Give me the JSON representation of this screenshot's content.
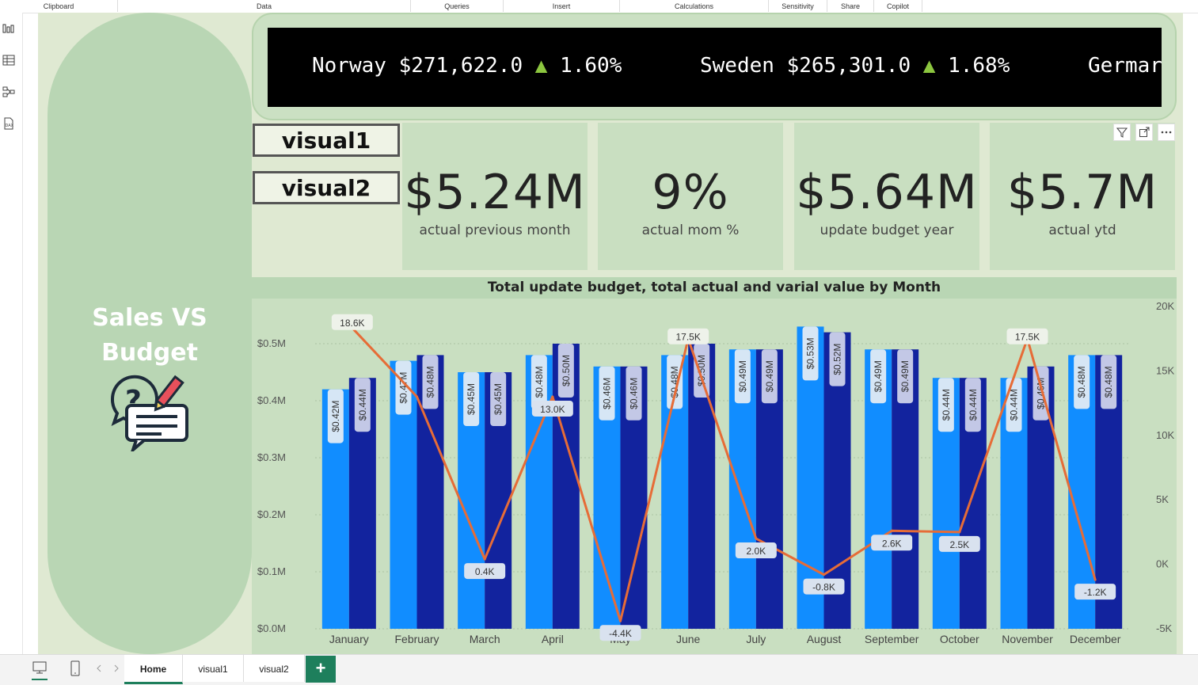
{
  "ribbon": {
    "groups": [
      {
        "label": "Clipboard"
      },
      {
        "label": "Data"
      },
      {
        "label": "Queries"
      },
      {
        "label": "Insert"
      },
      {
        "label": "Calculations"
      },
      {
        "label": "Sensitivity"
      },
      {
        "label": "Share"
      },
      {
        "label": "Copilot"
      }
    ]
  },
  "leftnav": [
    "report-view-icon",
    "table-view-icon",
    "model-view-icon",
    "dax-query-icon"
  ],
  "page": {
    "title": "Sales VS Budget",
    "title_line1": "Sales VS",
    "title_line2": "Budget"
  },
  "ticker": {
    "items": [
      {
        "country": "Norway",
        "value": "$271,622.0",
        "arrow": "▲",
        "change": "1.60%"
      },
      {
        "country": "Sweden",
        "value": "$265,301.0",
        "arrow": "▲",
        "change": "1.68%"
      },
      {
        "country": "Germar",
        "value": "",
        "arrow": "",
        "change": ""
      }
    ]
  },
  "nav_buttons": {
    "visual1": "visual1",
    "visual2": "visual2"
  },
  "cards": [
    {
      "value": "$5.24M",
      "label": "actual previous month"
    },
    {
      "value": "9%",
      "label": "actual mom %"
    },
    {
      "value": "$5.64M",
      "label": "update budget year"
    },
    {
      "value": "$5.7M",
      "label": "actual ytd"
    }
  ],
  "header_icons": [
    "filter-icon",
    "focus-mode-icon",
    "more-options-icon"
  ],
  "chart_data": {
    "type": "bar",
    "title": "Total update budget, total actual and varial value by Month",
    "categories": [
      "January",
      "February",
      "March",
      "April",
      "May",
      "June",
      "July",
      "August",
      "September",
      "October",
      "November",
      "December"
    ],
    "series": [
      {
        "name": "total update budget",
        "type": "bar",
        "color": "#118dff",
        "values": [
          0.42,
          0.47,
          0.45,
          0.48,
          0.46,
          0.48,
          0.49,
          0.53,
          0.49,
          0.44,
          0.44,
          0.48
        ],
        "labels": [
          "$0.42M",
          "$0.47M",
          "$0.45M",
          "$0.48M",
          "$0.46M",
          "$0.48M",
          "$0.49M",
          "$0.53M",
          "$0.49M",
          "$0.44M",
          "$0.44M",
          "$0.48M"
        ]
      },
      {
        "name": "total actual",
        "type": "bar",
        "color": "#12239e",
        "values": [
          0.44,
          0.48,
          0.45,
          0.5,
          0.46,
          0.5,
          0.49,
          0.52,
          0.49,
          0.44,
          0.46,
          0.48
        ],
        "labels": [
          "$0.44M",
          "$0.48M",
          "$0.45M",
          "$0.50M",
          "$0.46M",
          "$0.50M",
          "$0.49M",
          "$0.52M",
          "$0.49M",
          "$0.44M",
          "$0.46M",
          "$0.48M"
        ]
      },
      {
        "name": "varial value",
        "type": "line",
        "color": "#e66c37",
        "values": [
          18.6,
          13.0,
          0.4,
          13.0,
          -4.4,
          17.5,
          2.0,
          -0.8,
          2.6,
          2.5,
          17.5,
          -1.2
        ],
        "labels": [
          "18.6K",
          "",
          "0.4K",
          "13.0K",
          "-4.4K",
          "17.5K",
          "2.0K",
          "-0.8K",
          "2.6K",
          "2.5K",
          "17.5K",
          "-1.2K"
        ]
      }
    ],
    "y_left": {
      "min": 0,
      "max": 0.5,
      "ticks": [
        0,
        0.1,
        0.2,
        0.3,
        0.4,
        0.5
      ],
      "tick_labels": [
        "$0.0M",
        "$0.1M",
        "$0.2M",
        "$0.3M",
        "$0.4M",
        "$0.5M"
      ]
    },
    "y_right": {
      "min": -5,
      "max": 20,
      "ticks": [
        -5,
        0,
        5,
        10,
        15,
        20
      ],
      "tick_labels": [
        "-5K",
        "0K",
        "5K",
        "10K",
        "15K",
        "20K"
      ]
    },
    "grid": true,
    "legend": "none"
  },
  "tabs": [
    {
      "label": "Home",
      "active": true
    },
    {
      "label": "visual1",
      "active": false
    },
    {
      "label": "visual2",
      "active": false
    }
  ],
  "add_tab_label": "+"
}
